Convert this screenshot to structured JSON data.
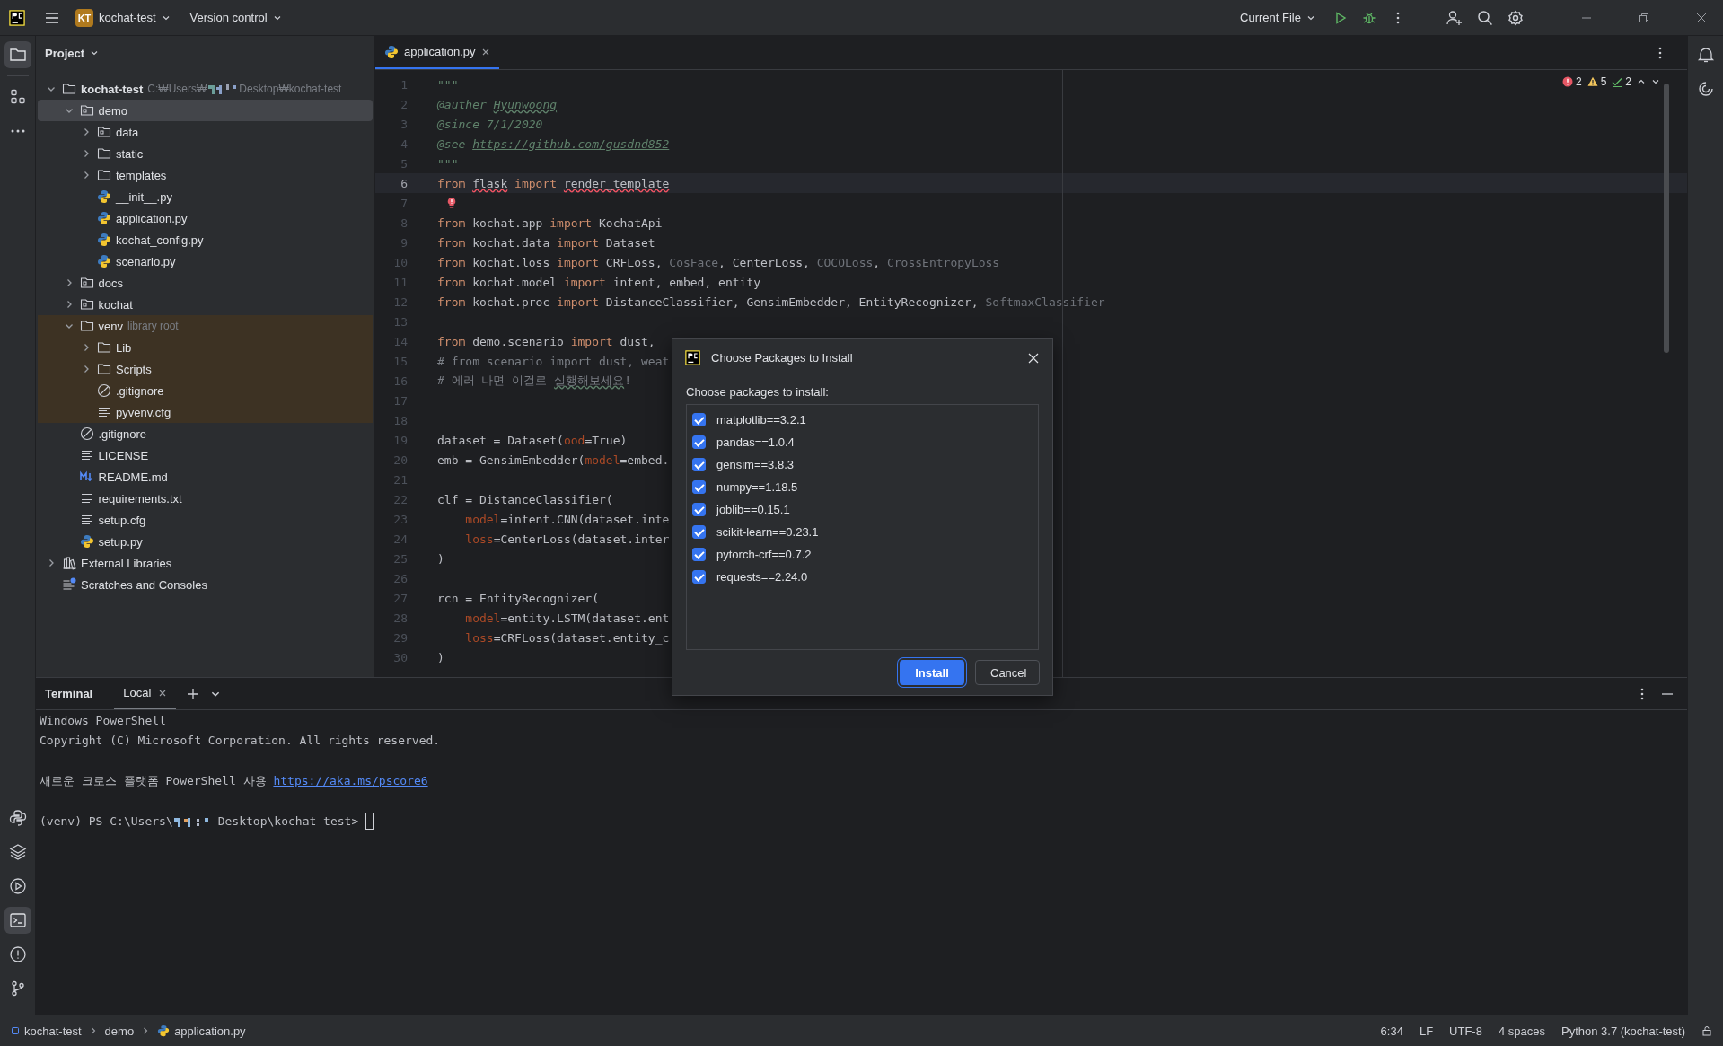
{
  "title_bar": {
    "project_badge": "KT",
    "project": "kochat-test",
    "vcs": "Version control",
    "run_config": "Current File"
  },
  "left_toolbar": {
    "top": [
      {
        "kind": "project",
        "selected": true
      },
      {
        "kind": "structure",
        "selected": false
      },
      {
        "kind": "more",
        "selected": false
      }
    ],
    "bottom": [
      {
        "kind": "python",
        "selected": false
      },
      {
        "kind": "layers",
        "selected": false
      },
      {
        "kind": "run",
        "selected": false
      },
      {
        "kind": "terminal",
        "selected": true
      },
      {
        "kind": "problems",
        "selected": false
      },
      {
        "kind": "git",
        "selected": false
      }
    ]
  },
  "right_toolbar": [
    {
      "kind": "bell"
    },
    {
      "kind": "spiral"
    }
  ],
  "project": {
    "title": "Project",
    "tree": [
      {
        "label": "kochat-test",
        "kind": "folder",
        "bold": true,
        "path": {
          "before": "C:₩Users₩",
          "after": "Desktop₩kochat-test"
        },
        "expanded": true,
        "selected": false,
        "children": [
          {
            "label": "demo",
            "kind": "module",
            "expanded": true,
            "selected": true,
            "children": [
              {
                "label": "data",
                "kind": "module",
                "expanded": false,
                "selected": false
              },
              {
                "label": "static",
                "kind": "folder",
                "expanded": false,
                "selected": false
              },
              {
                "label": "templates",
                "kind": "folder",
                "expanded": false,
                "selected": false
              },
              {
                "label": "__init__.py",
                "kind": "python",
                "selected": false
              },
              {
                "label": "application.py",
                "kind": "python",
                "selected": false
              },
              {
                "label": "kochat_config.py",
                "kind": "python",
                "selected": false
              },
              {
                "label": "scenario.py",
                "kind": "python",
                "selected": false
              }
            ]
          },
          {
            "label": "docs",
            "kind": "module",
            "expanded": false,
            "selected": false
          },
          {
            "label": "kochat",
            "kind": "module",
            "expanded": false,
            "selected": false
          },
          {
            "label": "venv",
            "kind": "folder",
            "note": "library root",
            "library_root": true,
            "expanded": true,
            "selected": false,
            "children": [
              {
                "label": "Lib",
                "kind": "folder",
                "expanded": false,
                "selected": false
              },
              {
                "label": "Scripts",
                "kind": "folder",
                "expanded": false,
                "selected": false
              },
              {
                "label": ".gitignore",
                "kind": "ignore",
                "selected": false
              },
              {
                "label": "pyvenv.cfg",
                "kind": "text",
                "selected": false
              }
            ]
          },
          {
            "label": ".gitignore",
            "kind": "ignore",
            "selected": false
          },
          {
            "label": "LICENSE",
            "kind": "text",
            "selected": false
          },
          {
            "label": "README.md",
            "kind": "markdown",
            "selected": false
          },
          {
            "label": "requirements.txt",
            "kind": "text",
            "selected": false
          },
          {
            "label": "setup.cfg",
            "kind": "text",
            "selected": false
          },
          {
            "label": "setup.py",
            "kind": "python",
            "selected": false
          }
        ]
      },
      {
        "label": "External Libraries",
        "kind": "library",
        "expanded": false,
        "selected": false
      },
      {
        "label": "Scratches and Consoles",
        "kind": "scratches",
        "selected": false
      }
    ]
  },
  "editor": {
    "tabs": [
      {
        "label": "application.py",
        "selected": true
      }
    ],
    "inspections": {
      "errors": "2",
      "warnings": "5",
      "weak": "2"
    },
    "lines": [
      {
        "number": "1",
        "current": false,
        "tokens": [
          {
            "text": "\"\"\"",
            "kind": "doc"
          }
        ]
      },
      {
        "number": "2",
        "current": false,
        "tokens": [
          {
            "text": "@auther ",
            "kind": "doc"
          },
          {
            "text": "Hyunwoong",
            "kind": "doc-typo"
          }
        ]
      },
      {
        "number": "3",
        "current": false,
        "tokens": [
          {
            "text": "@since 7/1/2020",
            "kind": "doc"
          }
        ]
      },
      {
        "number": "4",
        "current": false,
        "tokens": [
          {
            "text": "@see ",
            "kind": "doc"
          },
          {
            "text": "https://github.com/gusdnd852",
            "kind": "doc-link"
          }
        ]
      },
      {
        "number": "5",
        "current": false,
        "tokens": [
          {
            "text": "\"\"\"",
            "kind": "doc"
          }
        ]
      },
      {
        "number": "6",
        "current": true,
        "tokens": [
          {
            "text": "from ",
            "kind": "keyword"
          },
          {
            "text": "flask",
            "kind": "error"
          },
          {
            "text": " import ",
            "kind": "keyword"
          },
          {
            "text": "render_template",
            "kind": "error"
          }
        ]
      },
      {
        "number": "7",
        "current": false,
        "intention": true
      },
      {
        "number": "8",
        "current": false,
        "tokens": [
          {
            "text": "from",
            "kind": "keyword"
          },
          {
            "text": " kochat.app ",
            "kind": "plain"
          },
          {
            "text": "import",
            "kind": "keyword"
          },
          {
            "text": " KochatApi",
            "kind": "plain"
          }
        ]
      },
      {
        "number": "9",
        "current": false,
        "tokens": [
          {
            "text": "from",
            "kind": "keyword"
          },
          {
            "text": " kochat.data ",
            "kind": "plain"
          },
          {
            "text": "import",
            "kind": "keyword"
          },
          {
            "text": " Dataset",
            "kind": "plain"
          }
        ]
      },
      {
        "number": "10",
        "current": false,
        "tokens": [
          {
            "text": "from",
            "kind": "keyword"
          },
          {
            "text": " kochat.loss ",
            "kind": "plain"
          },
          {
            "text": "import",
            "kind": "keyword"
          },
          {
            "text": " CRFLoss, ",
            "kind": "plain"
          },
          {
            "text": "CosFace",
            "kind": "unused"
          },
          {
            "text": ", CenterLoss, ",
            "kind": "plain"
          },
          {
            "text": "COCOLoss",
            "kind": "unused"
          },
          {
            "text": ", ",
            "kind": "plain"
          },
          {
            "text": "CrossEntropyLoss",
            "kind": "unused"
          }
        ]
      },
      {
        "number": "11",
        "current": false,
        "tokens": [
          {
            "text": "from",
            "kind": "keyword"
          },
          {
            "text": " kochat.model ",
            "kind": "plain"
          },
          {
            "text": "import",
            "kind": "keyword"
          },
          {
            "text": " intent, embed, entity",
            "kind": "plain"
          }
        ]
      },
      {
        "number": "12",
        "current": false,
        "tokens": [
          {
            "text": "from",
            "kind": "keyword"
          },
          {
            "text": " kochat.proc ",
            "kind": "plain"
          },
          {
            "text": "import",
            "kind": "keyword"
          },
          {
            "text": " DistanceClassifier, GensimEmbedder, EntityRecognizer, ",
            "kind": "plain"
          },
          {
            "text": "SoftmaxClassifier",
            "kind": "unused"
          }
        ]
      },
      {
        "number": "13",
        "current": false
      },
      {
        "number": "14",
        "current": false,
        "tokens": [
          {
            "text": "from",
            "kind": "keyword"
          },
          {
            "text": " demo.scenario ",
            "kind": "plain"
          },
          {
            "text": "import",
            "kind": "keyword"
          },
          {
            "text": " dust,",
            "kind": "plain"
          }
        ]
      },
      {
        "number": "15",
        "current": false,
        "tokens": [
          {
            "text": "# from scenario import dust, weat",
            "kind": "comment"
          }
        ]
      },
      {
        "number": "16",
        "current": false,
        "tokens": [
          {
            "text": "# 에러 나면 이걸로 ",
            "kind": "comment"
          },
          {
            "text": "실행해보세요",
            "kind": "comment-typo"
          },
          {
            "text": "!",
            "kind": "comment"
          }
        ]
      },
      {
        "number": "17",
        "current": false
      },
      {
        "number": "18",
        "current": false
      },
      {
        "number": "19",
        "current": false,
        "tokens": [
          {
            "text": "dataset = Dataset(",
            "kind": "plain"
          },
          {
            "text": "ood",
            "kind": "param"
          },
          {
            "text": "=True)",
            "kind": "plain"
          }
        ]
      },
      {
        "number": "20",
        "current": false,
        "tokens": [
          {
            "text": "emb = GensimEmbedder(",
            "kind": "plain"
          },
          {
            "text": "model",
            "kind": "param"
          },
          {
            "text": "=embed.",
            "kind": "plain"
          }
        ]
      },
      {
        "number": "21",
        "current": false
      },
      {
        "number": "22",
        "current": false,
        "tokens": [
          {
            "text": "clf = DistanceClassifier(",
            "kind": "plain"
          }
        ]
      },
      {
        "number": "23",
        "current": false,
        "tokens": [
          {
            "text": "    model",
            "kind": "param"
          },
          {
            "text": "=intent.CNN(dataset.inte",
            "kind": "plain"
          }
        ]
      },
      {
        "number": "24",
        "current": false,
        "tokens": [
          {
            "text": "    loss",
            "kind": "param"
          },
          {
            "text": "=CenterLoss(dataset.inter",
            "kind": "plain"
          }
        ]
      },
      {
        "number": "25",
        "current": false,
        "tokens": [
          {
            "text": ")",
            "kind": "plain"
          }
        ]
      },
      {
        "number": "26",
        "current": false
      },
      {
        "number": "27",
        "current": false,
        "tokens": [
          {
            "text": "rcn = EntityRecognizer(",
            "kind": "plain"
          }
        ]
      },
      {
        "number": "28",
        "current": false,
        "tokens": [
          {
            "text": "    model",
            "kind": "param"
          },
          {
            "text": "=entity.LSTM(dataset.ent",
            "kind": "plain"
          }
        ]
      },
      {
        "number": "29",
        "current": false,
        "tokens": [
          {
            "text": "    loss",
            "kind": "param"
          },
          {
            "text": "=CRFLoss(dataset.entity_c",
            "kind": "plain"
          }
        ]
      },
      {
        "number": "30",
        "current": false,
        "tokens": [
          {
            "text": ")",
            "kind": "plain"
          }
        ]
      }
    ]
  },
  "dialog": {
    "title": "Choose Packages to Install",
    "prompt": "Choose packages to install:",
    "packages": [
      {
        "label": "matplotlib==3.2.1",
        "checked": true
      },
      {
        "label": "pandas==1.0.4",
        "checked": true
      },
      {
        "label": "gensim==3.8.3",
        "checked": true
      },
      {
        "label": "numpy==1.18.5",
        "checked": true
      },
      {
        "label": "joblib==0.15.1",
        "checked": true
      },
      {
        "label": "scikit-learn==0.23.1",
        "checked": true
      },
      {
        "label": "pytorch-crf==0.7.2",
        "checked": true
      },
      {
        "label": "requests==2.24.0",
        "checked": true
      }
    ],
    "buttons": [
      {
        "label": "Install",
        "kind": "primary"
      },
      {
        "label": "Cancel",
        "kind": "secondary"
      }
    ]
  },
  "terminal": {
    "title": "Terminal",
    "tabs": [
      {
        "label": "Local",
        "selected": true
      }
    ],
    "lines": [
      {
        "kind": "text",
        "segments": [
          {
            "text": "Windows PowerShell",
            "kind": "plain"
          }
        ]
      },
      {
        "kind": "text",
        "segments": [
          {
            "text": "Copyright (C) Microsoft Corporation. All rights reserved.",
            "kind": "plain"
          }
        ]
      },
      {
        "kind": "blank"
      },
      {
        "kind": "text",
        "segments": [
          {
            "text": "새로운 크로스 플랫폼 PowerShell 사용 ",
            "kind": "plain"
          },
          {
            "text": "https://aka.ms/pscore6",
            "kind": "link"
          }
        ]
      },
      {
        "kind": "blank"
      },
      {
        "kind": "prompt",
        "before": "(venv) PS C:\\Users\\",
        "after": "Desktop\\kochat-test>"
      }
    ]
  },
  "status_bar": {
    "breadcrumbs": [
      {
        "label": "kochat-test",
        "kind": "module"
      },
      {
        "label": "demo",
        "kind": "folder"
      },
      {
        "label": "application.py",
        "kind": "python"
      }
    ],
    "items": [
      "6:34",
      "LF",
      "UTF-8",
      "4 spaces",
      "Python 3.7 (kochat-test)"
    ]
  }
}
